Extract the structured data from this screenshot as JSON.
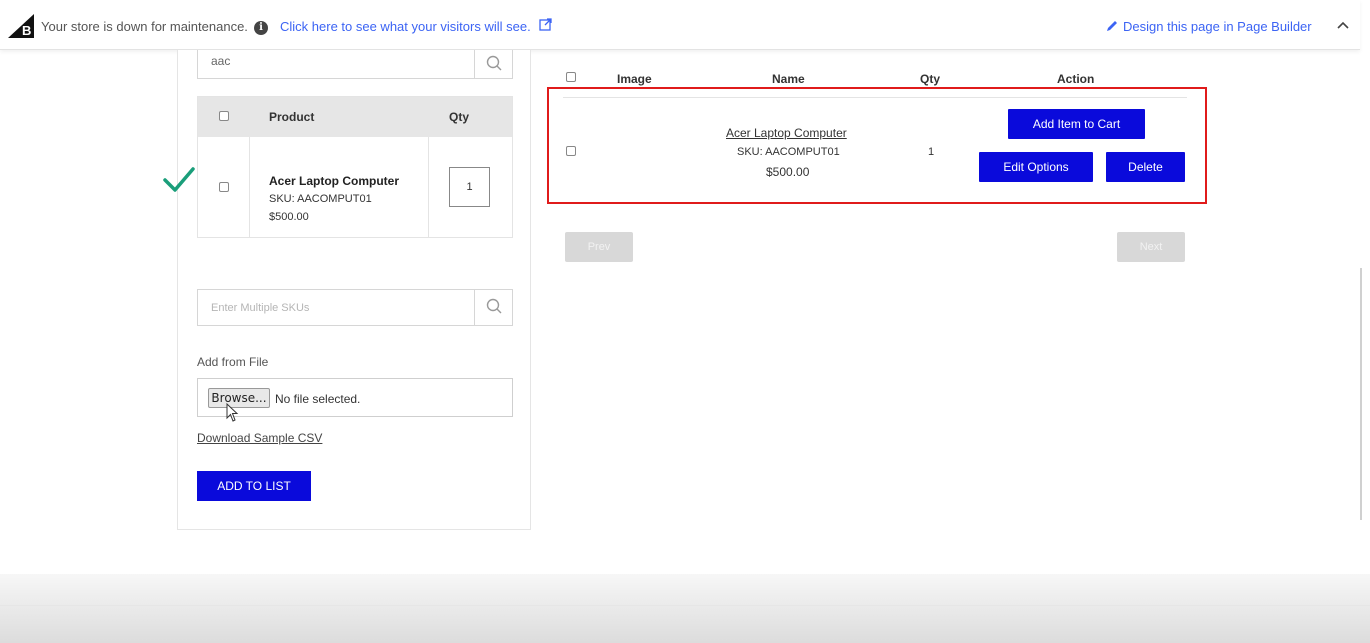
{
  "topbar": {
    "message": "Your store is down for maintenance.",
    "visitor_link": "Click here to see what your visitors will see.",
    "design_link": "Design this page in Page Builder"
  },
  "left": {
    "search_value": "aac",
    "table": {
      "col_product": "Product",
      "col_qty": "Qty",
      "row": {
        "name": "Acer Laptop Computer",
        "sku": "SKU: AACOMPUT01",
        "price": "$500.00",
        "qty": "1"
      }
    },
    "sku_placeholder": "Enter Multiple SKUs",
    "add_from_file_label": "Add from File",
    "browse_label": "Browse...",
    "file_status": "No file selected.",
    "download_csv": "Download Sample CSV",
    "add_to_list": "ADD TO LIST"
  },
  "right": {
    "headers": {
      "image": "Image",
      "name": "Name",
      "qty": "Qty",
      "action": "Action"
    },
    "item": {
      "name": "Acer Laptop Computer",
      "sku": "SKU: AACOMPUT01",
      "price": "$500.00",
      "qty": "1"
    },
    "add_to_cart": "Add Item to Cart",
    "edit_options": "Edit Options",
    "delete": "Delete",
    "prev": "Prev",
    "next": "Next"
  },
  "colors": {
    "primary_button": "#0a0adb",
    "link": "#3c64f4",
    "highlight_border": "#e01b1b",
    "checkmark": "#1a9e7a"
  }
}
